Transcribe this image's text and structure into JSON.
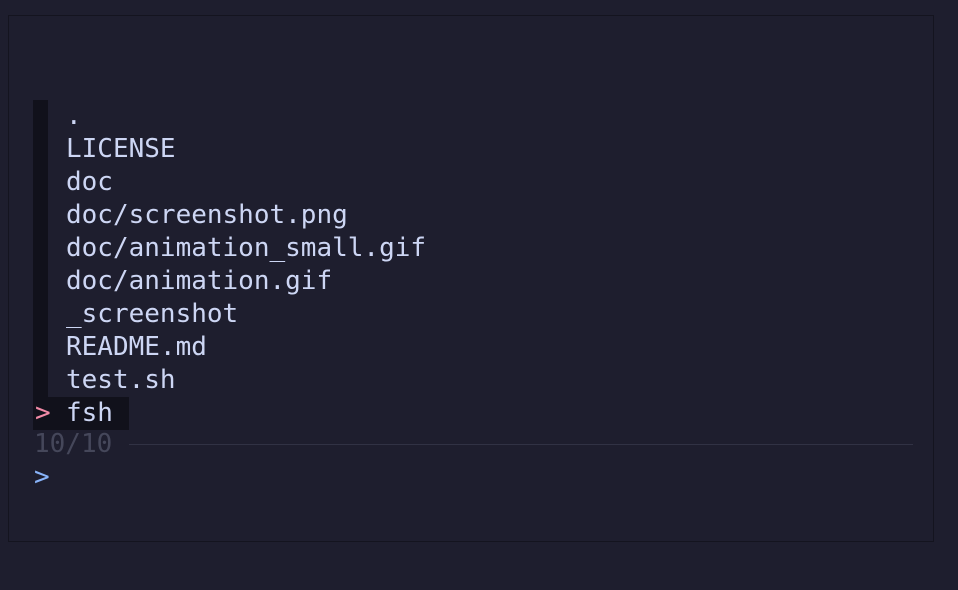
{
  "finder": {
    "items": [
      ".",
      "LICENSE",
      "doc",
      "doc/screenshot.png",
      "doc/animation_small.gif",
      "doc/animation.gif",
      "_screenshot",
      "README.md",
      "test.sh"
    ],
    "selected": {
      "pointer": ">",
      "label": "fsh"
    },
    "count": "10/10",
    "prompt": ">",
    "query": ""
  },
  "colors": {
    "background": "#1e1e2e",
    "text": "#cdd6f4",
    "pointer": "#f38ba8",
    "prompt": "#89b4fa",
    "gutter": "#11111b",
    "count": "#45475a"
  }
}
